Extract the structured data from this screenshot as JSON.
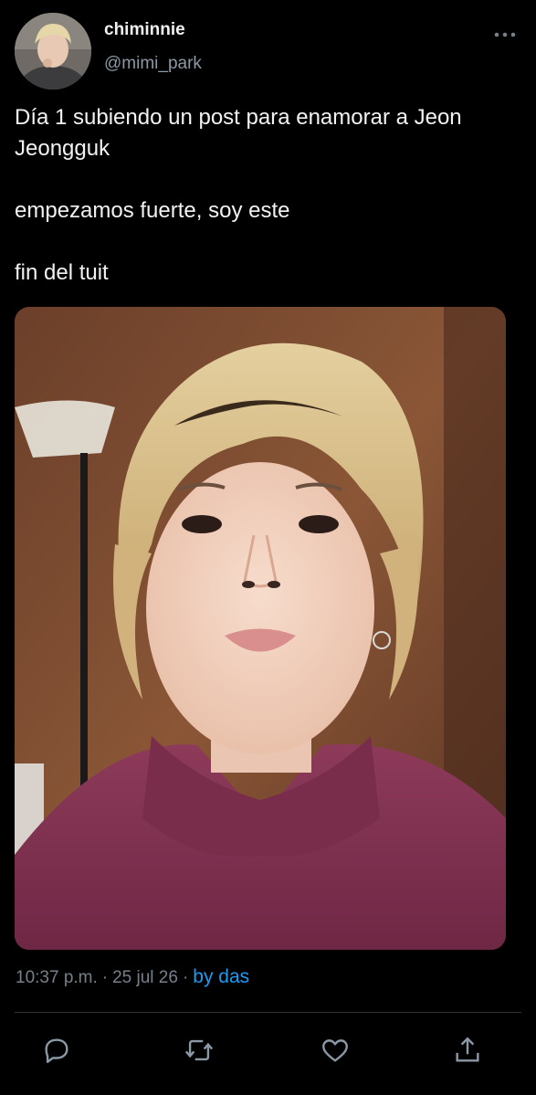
{
  "author": {
    "display_name": "chiminnie",
    "handle": "@mimi_park",
    "avatar_icon": "profile-avatar"
  },
  "tweet": {
    "text": "Día 1 subiendo un post para enamorar a Jeon Jeongguk\n\nempezamos fuerte, soy este\n\nfin del tuit",
    "media_alt_icon": "attached-photo"
  },
  "meta": {
    "time": "10:37 p.m.",
    "date": "25 jul 26",
    "separator": "·",
    "source": "by das"
  },
  "actions": {
    "reply_icon": "reply-icon",
    "retweet_icon": "retweet-icon",
    "like_icon": "heart-icon",
    "share_icon": "share-icon"
  },
  "colors": {
    "background": "#000000",
    "text": "#e7e9ea",
    "secondary": "#8b98a5",
    "accent": "#1d9bf0",
    "divider": "#2f3336"
  }
}
